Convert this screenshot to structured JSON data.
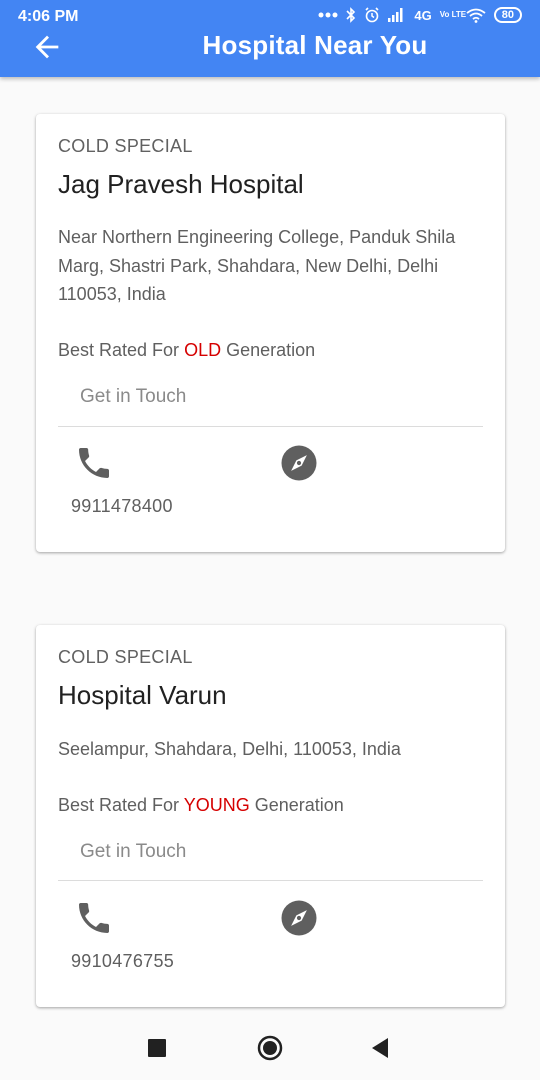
{
  "status_bar": {
    "time": "4:06 PM",
    "network": "4G",
    "volte": "Vo LTE",
    "battery": "80"
  },
  "app_bar": {
    "title": "Hospital Near You",
    "back_icon": "arrow-back-icon",
    "color": "#4385f3"
  },
  "hospitals": [
    {
      "category": "COLD SPECIAL",
      "name": "Jag Pravesh Hospital",
      "address": "Near Northern Engineering College, Panduk Shila Marg, Shastri Park, Shahdara, New Delhi, Delhi 110053, India",
      "rated_prefix": "Best Rated For ",
      "rated_highlight": "OLD",
      "rated_suffix": " Generation",
      "contact_label": "Get in Touch",
      "phone": "9911478400",
      "phone_icon": "phone-icon",
      "nav_icon": "compass-icon"
    },
    {
      "category": "COLD SPECIAL",
      "name": "Hospital Varun",
      "address": "Seelampur, Shahdara, Delhi, 110053, India",
      "rated_prefix": "Best Rated For ",
      "rated_highlight": "YOUNG",
      "rated_suffix": " Generation",
      "contact_label": "Get in Touch",
      "phone": "9910476755",
      "phone_icon": "phone-icon",
      "nav_icon": "compass-icon"
    }
  ],
  "highlight_color": "#d50000",
  "system_nav": {
    "recent_icon": "square-icon",
    "home_icon": "circle-home-icon",
    "back_icon": "triangle-back-icon"
  }
}
